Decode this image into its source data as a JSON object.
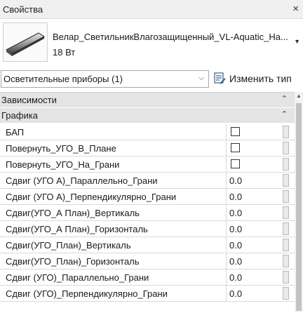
{
  "panel": {
    "title": "Свойства",
    "close_icon": "×"
  },
  "type_selector": {
    "family_name": "Велар_СветильникВлагозащищенный_VL-Aquatic_Ha...",
    "type_name": "18 Вт"
  },
  "filter": {
    "selected": "Осветительные приборы (1)",
    "edit_type_label": "Изменить тип"
  },
  "categories": {
    "constraints": "Зависимости",
    "graphics": "Графика"
  },
  "rows": [
    {
      "name": "БАП",
      "value": ""
    },
    {
      "name": "Повернуть_УГО_В_Плане",
      "value": ""
    },
    {
      "name": "Повернуть_УГО_На_Грани",
      "value": ""
    },
    {
      "name": "Сдвиг (УГО А)_Параллельно_Грани",
      "value": "0.0"
    },
    {
      "name": "Сдвиг (УГО А)_Перпендикулярно_Грани",
      "value": "0.0"
    },
    {
      "name": "Сдвиг(УГО_А План)_Вертикаль",
      "value": "0.0"
    },
    {
      "name": "Сдвиг(УГО_А План)_Горизонталь",
      "value": "0.0"
    },
    {
      "name": "Сдвиг(УГО_План)_Вертикаль",
      "value": "0.0"
    },
    {
      "name": "Сдвиг(УГО_План)_Горизонталь",
      "value": "0.0"
    },
    {
      "name": "Сдвиг (УГО)_Параллельно_Грани",
      "value": "0.0"
    },
    {
      "name": "Сдвиг (УГО)_Перпендикулярно_Грани",
      "value": "0.0"
    }
  ]
}
